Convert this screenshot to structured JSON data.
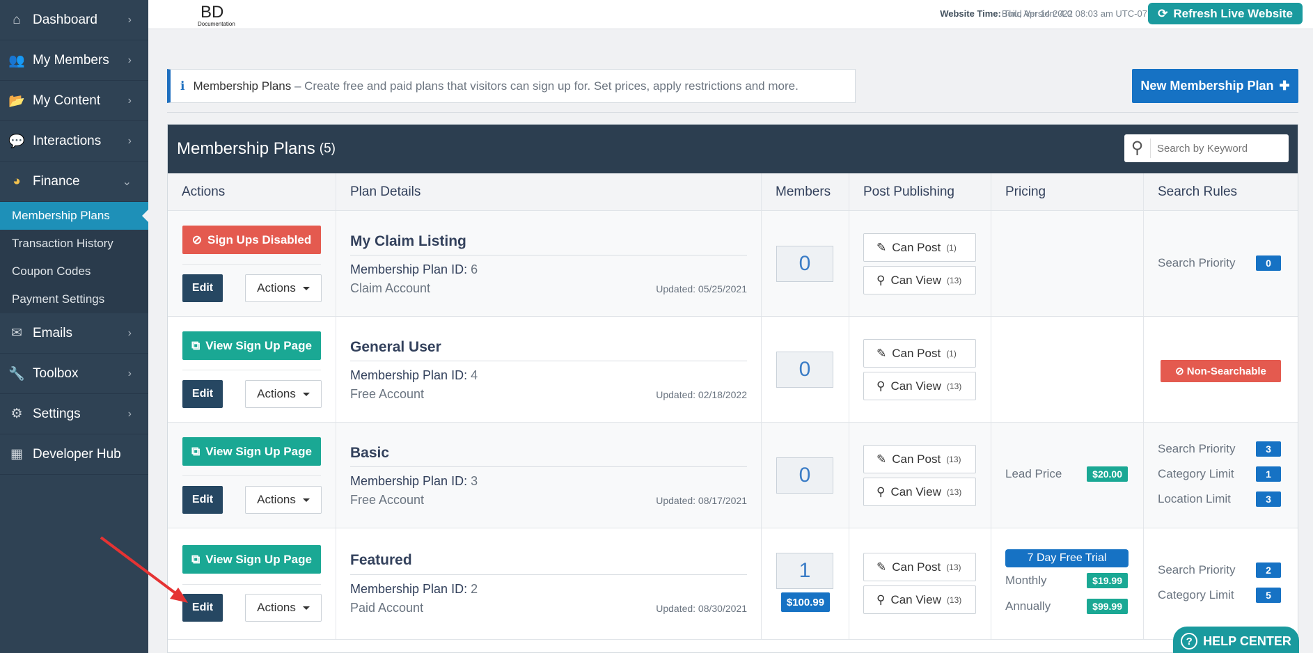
{
  "sidebar": {
    "items": [
      {
        "label": "Dashboard",
        "icon": "home-icon",
        "glyph": "⌂"
      },
      {
        "label": "My Members",
        "icon": "users-icon",
        "glyph": "👥"
      },
      {
        "label": "My Content",
        "icon": "folder-icon",
        "glyph": "📂"
      },
      {
        "label": "Interactions",
        "icon": "comments-icon",
        "glyph": "💬"
      },
      {
        "label": "Finance",
        "icon": "pie-chart-icon",
        "glyph": "◕"
      }
    ],
    "finance_sub": [
      "Membership Plans",
      "Transaction History",
      "Coupon Codes",
      "Payment Settings"
    ],
    "items2": [
      {
        "label": "Emails",
        "icon": "inbox-icon",
        "glyph": "✉"
      },
      {
        "label": "Toolbox",
        "icon": "wrench-icon",
        "glyph": "🔧"
      },
      {
        "label": "Settings",
        "icon": "gear-icon",
        "glyph": "⚙"
      },
      {
        "label": "Developer Hub",
        "icon": "grid-icon",
        "glyph": "▦"
      }
    ]
  },
  "topbar": {
    "logo_text": "BD",
    "logo_sub": "Documentation",
    "build_label": "Build Version: 4.0",
    "time_label": "Website Time:",
    "time_value": "Thu, Apr 14 2022 08:03 am UTC-07:00",
    "refresh_label": "Refresh Live Website"
  },
  "info": {
    "title": "Membership Plans",
    "text": " – Create free and paid plans that visitors can sign up for. Set prices, apply restrictions and more."
  },
  "new_plan_label": "New Membership Plan",
  "panel": {
    "title": "Membership Plans",
    "count": "(5)",
    "search_placeholder": "Search by Keyword",
    "columns": [
      "Actions",
      "Plan Details",
      "Members",
      "Post Publishing",
      "Pricing",
      "Search Rules"
    ]
  },
  "rows": [
    {
      "top_button": "Sign Ups Disabled",
      "edit": "Edit",
      "actions": "Actions",
      "name": "My Claim Listing",
      "id_label": "Membership Plan ID:",
      "id": "6",
      "type": "Claim Account",
      "updated": "Updated: 05/25/2021",
      "members": "0",
      "can_post": "Can Post",
      "post_count": "(1)",
      "can_view": "Can View",
      "view_count": "(13)",
      "search": [
        {
          "label": "Search Priority",
          "value": "0"
        }
      ]
    },
    {
      "top_button": "View Sign Up Page",
      "edit": "Edit",
      "actions": "Actions",
      "name": "General User",
      "id_label": "Membership Plan ID:",
      "id": "4",
      "type": "Free Account",
      "updated": "Updated: 02/18/2022",
      "members": "0",
      "can_post": "Can Post",
      "post_count": "(1)",
      "can_view": "Can View",
      "view_count": "(13)",
      "non_searchable": "Non-Searchable"
    },
    {
      "top_button": "View Sign Up Page",
      "edit": "Edit",
      "actions": "Actions",
      "name": "Basic",
      "id_label": "Membership Plan ID:",
      "id": "3",
      "type": "Free Account",
      "updated": "Updated: 08/17/2021",
      "members": "0",
      "can_post": "Can Post",
      "post_count": "(13)",
      "can_view": "Can View",
      "view_count": "(13)",
      "pricing": [
        {
          "label": "Lead Price",
          "value": "$20.00"
        }
      ],
      "search": [
        {
          "label": "Search Priority",
          "value": "3"
        },
        {
          "label": "Category Limit",
          "value": "1"
        },
        {
          "label": "Location Limit",
          "value": "3"
        }
      ]
    },
    {
      "top_button": "View Sign Up Page",
      "edit": "Edit",
      "actions": "Actions",
      "name": "Featured",
      "id_label": "Membership Plan ID:",
      "id": "2",
      "type": "Paid Account",
      "updated": "Updated: 08/30/2021",
      "members": "1",
      "member_price": "$100.99",
      "can_post": "Can Post",
      "post_count": "(13)",
      "can_view": "Can View",
      "view_count": "(13)",
      "trial": "7 Day Free Trial",
      "pricing": [
        {
          "label": "Monthly",
          "value": "$19.99"
        },
        {
          "label": "Annually",
          "value": "$99.99"
        }
      ],
      "search": [
        {
          "label": "Search Priority",
          "value": "2"
        },
        {
          "label": "Category Limit",
          "value": "5"
        }
      ]
    }
  ],
  "help_label": "HELP CENTER",
  "colors": {
    "sidebar": "#2f4254",
    "accent": "#1672c4",
    "teal": "#1aa894",
    "danger": "#e45a4f",
    "active": "#1e90b8"
  }
}
